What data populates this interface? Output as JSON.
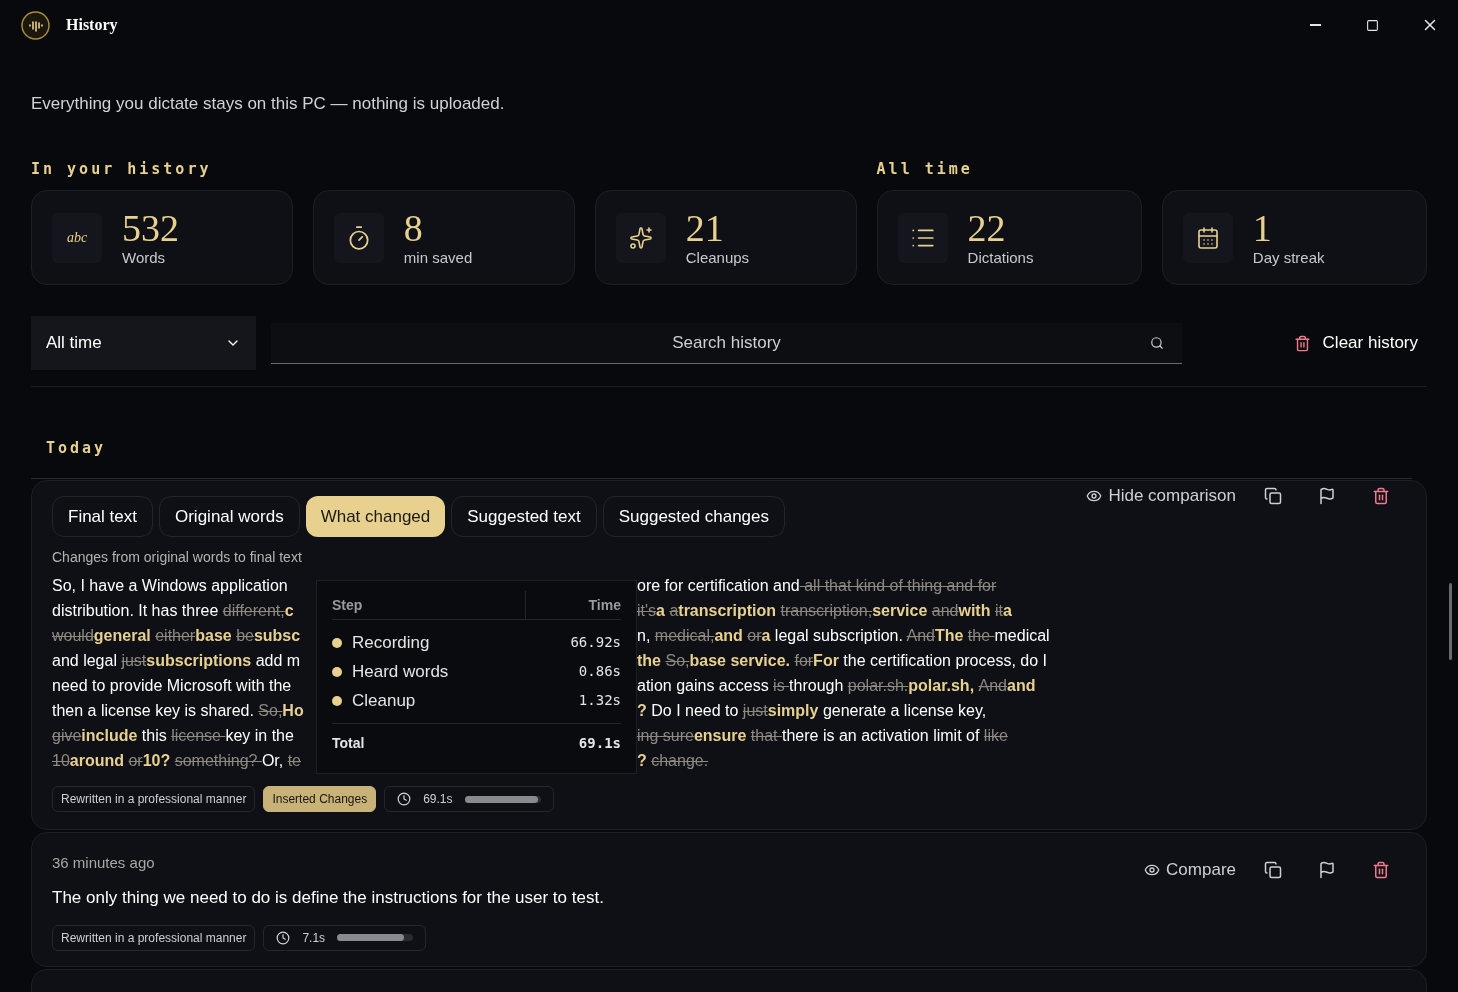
{
  "window": {
    "title": "History"
  },
  "privacy_note": "Everything you dictate stays on this PC — nothing is uploaded.",
  "stat_groups": [
    {
      "label": "In your history",
      "cards": [
        {
          "kind": "words",
          "icon_text": "abc",
          "value": "532",
          "label": "Words"
        },
        {
          "kind": "time",
          "value": "8",
          "label": "min saved"
        },
        {
          "kind": "cleanups",
          "value": "21",
          "label": "Cleanups"
        }
      ]
    },
    {
      "label": "All time",
      "cards": [
        {
          "kind": "dictations",
          "value": "22",
          "label": "Dictations"
        },
        {
          "kind": "streak",
          "value": "1",
          "label": "Day streak"
        }
      ]
    }
  ],
  "filter": {
    "range": "All time",
    "search_placeholder": "Search history",
    "clear": "Clear history"
  },
  "section": "Today",
  "entries": [
    {
      "toggle": "Hide comparison",
      "tabs": [
        {
          "label": "Final text",
          "selected": false
        },
        {
          "label": "Original words",
          "selected": false
        },
        {
          "label": "What changed",
          "selected": true
        },
        {
          "label": "Suggested text",
          "selected": false
        },
        {
          "label": "Suggested changes",
          "selected": false
        }
      ],
      "caption": "Changes from original words to final text",
      "diff_lines": [
        {
          "left": [
            {
              "kind": "plain",
              "text": "So, I have a Windows application"
            }
          ],
          "right": [
            {
              "kind": "plain",
              "text": "ore for certification and"
            },
            {
              "kind": "removed",
              "text": " all that kind of thing and for"
            }
          ]
        },
        {
          "left": [
            {
              "kind": "plain",
              "text": "distribution. It has three "
            },
            {
              "kind": "removed",
              "text": "different,"
            },
            {
              "kind": "added",
              "text": "c"
            }
          ],
          "right": [
            {
              "kind": "removed",
              "text": "it's"
            },
            {
              "kind": "added",
              "text": "a "
            },
            {
              "kind": "removed",
              "text": "a"
            },
            {
              "kind": "added",
              "text": "transcription "
            },
            {
              "kind": "removed",
              "text": "transcription,"
            },
            {
              "kind": "added",
              "text": "service "
            },
            {
              "kind": "removed",
              "text": "and"
            },
            {
              "kind": "added",
              "text": "with "
            },
            {
              "kind": "removed",
              "text": "it"
            },
            {
              "kind": "added",
              "text": "a"
            }
          ]
        },
        {
          "left": [
            {
              "kind": "removed",
              "text": "would"
            },
            {
              "kind": "added",
              "text": "general "
            },
            {
              "kind": "removed",
              "text": "either"
            },
            {
              "kind": "added",
              "text": "base "
            },
            {
              "kind": "removed",
              "text": "be"
            },
            {
              "kind": "added",
              "text": "subsc"
            }
          ],
          "right": [
            {
              "kind": "plain",
              "text": "n, "
            },
            {
              "kind": "removed",
              "text": "medical,"
            },
            {
              "kind": "added",
              "text": "and "
            },
            {
              "kind": "removed",
              "text": "or"
            },
            {
              "kind": "added",
              "text": "a"
            },
            {
              "kind": "plain",
              "text": " legal subscription. "
            },
            {
              "kind": "removed",
              "text": "And"
            },
            {
              "kind": "added",
              "text": "The "
            },
            {
              "kind": "removed",
              "text": "the "
            },
            {
              "kind": "plain",
              "text": "medical"
            }
          ]
        },
        {
          "left": [
            {
              "kind": "plain",
              "text": "and legal "
            },
            {
              "kind": "removed",
              "text": "just"
            },
            {
              "kind": "added",
              "text": "subscriptions"
            },
            {
              "kind": "plain",
              "text": " add m"
            }
          ],
          "right": [
            {
              "kind": "added",
              "text": "the "
            },
            {
              "kind": "removed",
              "text": "So,"
            },
            {
              "kind": "added",
              "text": "base service. "
            },
            {
              "kind": "removed",
              "text": "for"
            },
            {
              "kind": "added",
              "text": "For"
            },
            {
              "kind": "plain",
              "text": " the certification process, do I"
            }
          ]
        },
        {
          "left": [
            {
              "kind": "plain",
              "text": "need to provide Microsoft with the"
            }
          ],
          "right": [
            {
              "kind": "plain",
              "text": "ation gains access "
            },
            {
              "kind": "removed",
              "text": "is "
            },
            {
              "kind": "plain",
              "text": "through "
            },
            {
              "kind": "removed",
              "text": "polar.sh."
            },
            {
              "kind": "added",
              "text": "polar.sh, "
            },
            {
              "kind": "removed",
              "text": "And"
            },
            {
              "kind": "added",
              "text": "and"
            }
          ]
        },
        {
          "left": [
            {
              "kind": "plain",
              "text": "then a license key is shared. "
            },
            {
              "kind": "removed",
              "text": "So,"
            },
            {
              "kind": "added",
              "text": "Ho"
            }
          ],
          "right": [
            {
              "kind": "added",
              "text": "?"
            },
            {
              "kind": "plain",
              "text": " Do I need to "
            },
            {
              "kind": "removed",
              "text": "just"
            },
            {
              "kind": "added",
              "text": "simply"
            },
            {
              "kind": "plain",
              "text": " generate a license key,"
            }
          ]
        },
        {
          "left": [
            {
              "kind": "removed",
              "text": "give"
            },
            {
              "kind": "added",
              "text": "include"
            },
            {
              "kind": "plain",
              "text": " this "
            },
            {
              "kind": "removed",
              "text": "license "
            },
            {
              "kind": "plain",
              "text": "key in the"
            }
          ],
          "right": [
            {
              "kind": "removed",
              "text": "ing sure"
            },
            {
              "kind": "added",
              "text": "ensure "
            },
            {
              "kind": "removed",
              "text": "that "
            },
            {
              "kind": "plain",
              "text": "there is an activation limit of "
            },
            {
              "kind": "removed",
              "text": "like"
            }
          ]
        },
        {
          "left": [
            {
              "kind": "removed",
              "text": "10"
            },
            {
              "kind": "added",
              "text": "around "
            },
            {
              "kind": "removed",
              "text": "or"
            },
            {
              "kind": "added",
              "text": "10? "
            },
            {
              "kind": "removed",
              "text": "something? "
            },
            {
              "kind": "plain",
              "text": "Or, "
            },
            {
              "kind": "removed",
              "text": "te"
            }
          ],
          "right": [
            {
              "kind": "added",
              "text": "? "
            },
            {
              "kind": "removed",
              "text": "change."
            }
          ]
        }
      ],
      "tooltip": {
        "step_heading": "Step",
        "time_heading": "Time",
        "steps": [
          {
            "name": "Recording",
            "time": "66.92s"
          },
          {
            "name": "Heard words",
            "time": "0.86s"
          },
          {
            "name": "Cleanup",
            "time": "1.32s"
          }
        ],
        "total_label": "Total",
        "total": "69.1s"
      },
      "chips": [
        {
          "label": "Rewritten in a professional manner",
          "highlighted": false
        },
        {
          "label": "Inserted Changes",
          "highlighted": true
        }
      ],
      "duration": "69.1s",
      "level": 0.97
    },
    {
      "time": "36 minutes ago",
      "toggle": "Compare",
      "text": "The only thing we need to do is define the instructions for the user to test.",
      "chips": [
        {
          "label": "Rewritten in a professional manner",
          "highlighted": false
        }
      ],
      "duration": "7.1s",
      "level": 0.88
    }
  ]
}
